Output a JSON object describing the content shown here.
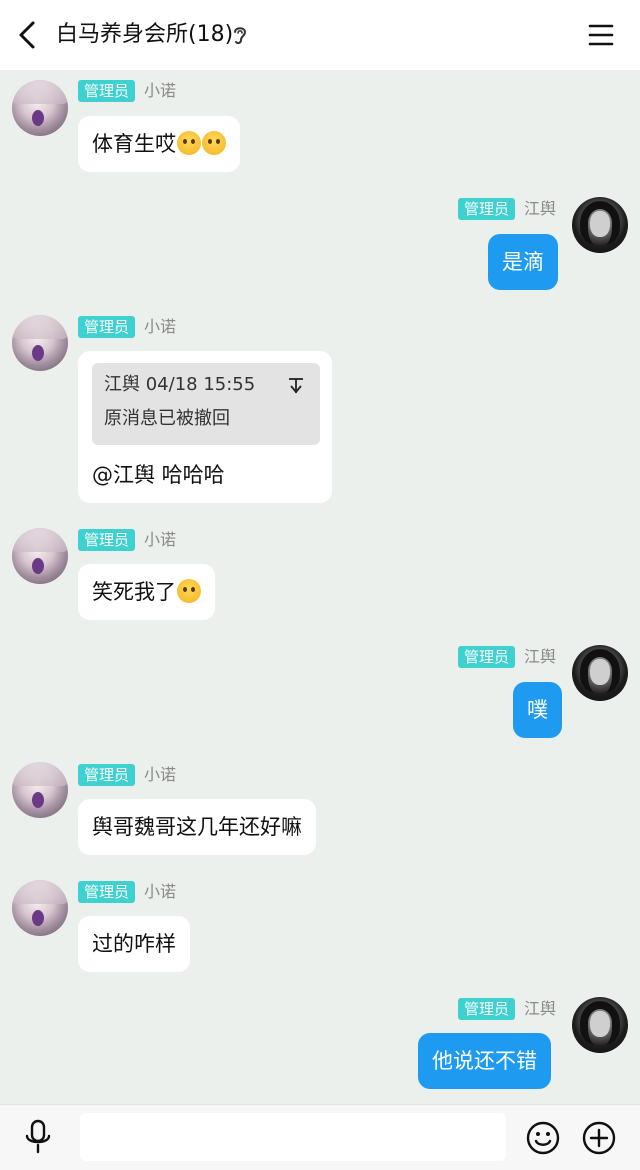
{
  "header": {
    "title": "白马养身会所(18)"
  },
  "messages": [
    {
      "side": "in",
      "badge": "管理员",
      "sender": "小诺",
      "text": "体育生哎"
    },
    {
      "side": "out",
      "badge": "管理员",
      "sender": "江舆",
      "text": "是滴"
    },
    {
      "side": "in",
      "badge": "管理员",
      "sender": "小诺",
      "reply_meta": "江舆 04/18 15:55",
      "reply_text": "原消息已被撤回",
      "text": "@江舆 哈哈哈"
    },
    {
      "side": "in",
      "badge": "管理员",
      "sender": "小诺",
      "text": "笑死我了"
    },
    {
      "side": "out",
      "badge": "管理员",
      "sender": "江舆",
      "text": "噗"
    },
    {
      "side": "in",
      "badge": "管理员",
      "sender": "小诺",
      "text": "舆哥魏哥这几年还好嘛"
    },
    {
      "side": "in",
      "badge": "管理员",
      "sender": "小诺",
      "text": "过的咋样"
    },
    {
      "side": "out",
      "badge": "管理员",
      "sender": "江舆",
      "text": "他说还不错"
    }
  ],
  "input": {
    "value": ""
  },
  "icons": {
    "back": "chevron-left-icon",
    "ear": "ear-icon",
    "menu": "menu-icon",
    "mic": "microphone-icon",
    "emoji": "smiley-icon",
    "plus": "plus-icon"
  },
  "colors": {
    "badge": "#3fd0d0",
    "outgoing_bubble": "#1e9bf0",
    "chat_background": "#ecf0ec"
  }
}
